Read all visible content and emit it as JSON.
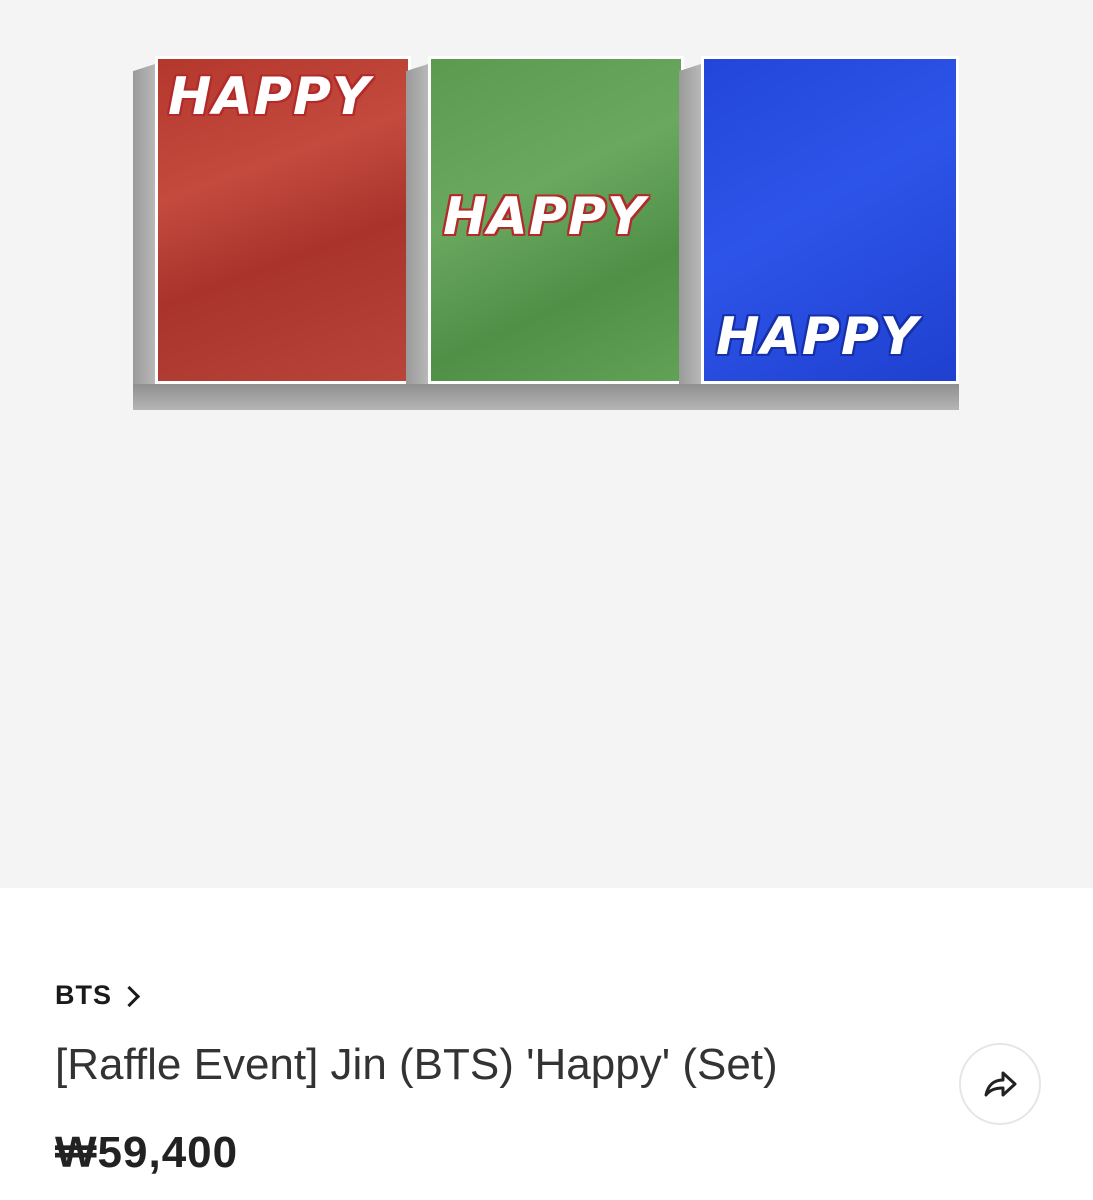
{
  "product_gallery": {
    "album_versions": [
      {
        "color": "red",
        "cover_text": "HAPPY"
      },
      {
        "color": "green",
        "cover_text": "HAPPY"
      },
      {
        "color": "blue",
        "cover_text": "HAPPY"
      }
    ]
  },
  "product": {
    "artist": "BTS",
    "title": "[Raffle Event] Jin (BTS) 'Happy' (Set)",
    "price": "₩59,400",
    "share_icon": "share-icon"
  },
  "colors": {
    "gallery_background": "#f4f4f4",
    "red_album": "#b4372c",
    "green_album": "#5b9a4f",
    "blue_album": "#2246d9"
  }
}
